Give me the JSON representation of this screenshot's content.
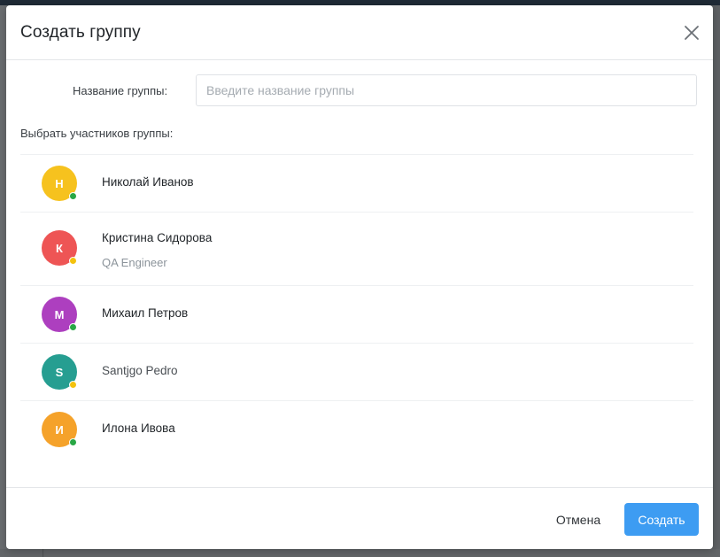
{
  "modal": {
    "title": "Создать группу",
    "name_label": "Название группы:",
    "name_value": "",
    "name_placeholder": "Введите название группы",
    "members_label": "Выбрать участников группы:",
    "cancel_label": "Отмена",
    "create_label": "Создать"
  },
  "members": [
    {
      "initial": "Н",
      "name": "Николай Иванов",
      "role": "",
      "avatar_color": "#f6c21e",
      "status": "online",
      "status_color": "#28a745"
    },
    {
      "initial": "К",
      "name": "Кристина Сидорова",
      "role": "QA Engineer",
      "avatar_color": "#ee5555",
      "status": "away",
      "status_color": "#f4c20d"
    },
    {
      "initial": "М",
      "name": "Михаил Петров",
      "role": "",
      "avatar_color": "#ad3fbf",
      "status": "online",
      "status_color": "#28a745"
    },
    {
      "initial": "S",
      "name": "Santjgo Pedro",
      "role": "",
      "avatar_color": "#269e91",
      "status": "away",
      "status_color": "#f4c20d"
    },
    {
      "initial": "И",
      "name": "Илона Ивова",
      "role": "",
      "avatar_color": "#f5a22a",
      "status": "online",
      "status_color": "#28a745"
    }
  ],
  "colors": {
    "primary": "#3d9cf2",
    "overlay": "#5e6164"
  },
  "icons": {
    "close": "close-icon"
  }
}
